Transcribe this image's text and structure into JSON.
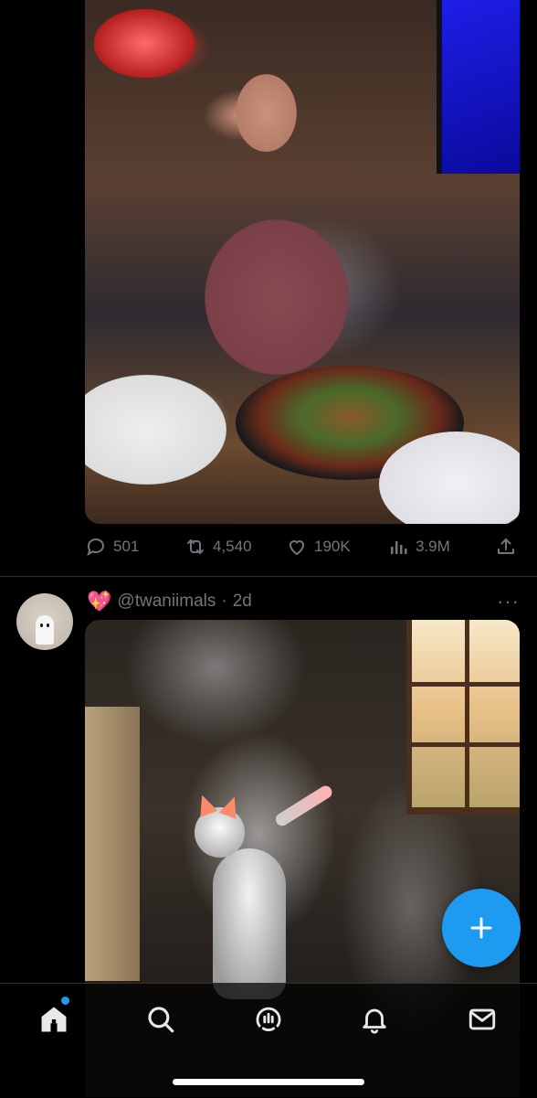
{
  "post1": {
    "image": {
      "kind": "photo"
    },
    "actions": {
      "replies": "501",
      "reposts": "4,540",
      "likes": "190K",
      "views": "3.9M"
    }
  },
  "post2": {
    "author_badge": "💖",
    "handle": "@twaniimals",
    "separator": "·",
    "time": "2d",
    "more": "···",
    "image": {
      "kind": "photo"
    }
  },
  "fab": {
    "icon": "plus-icon",
    "color": "#1d9bf0"
  },
  "bottom_nav": {
    "items": [
      {
        "name": "home",
        "icon": "home-icon",
        "active": true,
        "has_dot": true
      },
      {
        "name": "search",
        "icon": "search-icon"
      },
      {
        "name": "grok",
        "icon": "grok-icon"
      },
      {
        "name": "notifications",
        "icon": "bell-icon"
      },
      {
        "name": "messages",
        "icon": "envelope-icon"
      }
    ],
    "accent": "#1d9bf0"
  },
  "colors": {
    "background": "#000000",
    "muted_text": "#71767b",
    "divider": "#2f3336"
  }
}
